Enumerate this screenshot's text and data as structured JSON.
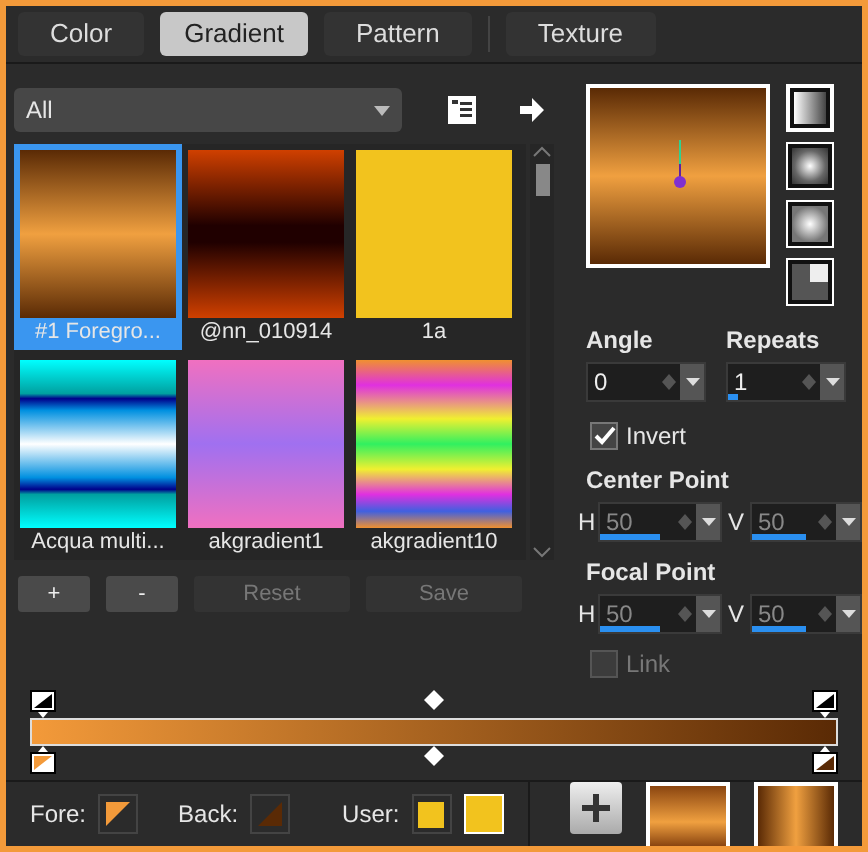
{
  "tabs": [
    {
      "label": "Color",
      "selected": false
    },
    {
      "label": "Gradient",
      "selected": true
    },
    {
      "label": "Pattern",
      "selected": false
    },
    {
      "label": "Texture",
      "selected": false
    }
  ],
  "category_dropdown": {
    "value": "All"
  },
  "gradients": [
    {
      "name": "#1 Foregro...",
      "selected": true
    },
    {
      "name": "@nn_010914",
      "selected": false
    },
    {
      "name": "1a",
      "selected": false
    },
    {
      "name": "Acqua multi...",
      "selected": false
    },
    {
      "name": "akgradient1",
      "selected": false
    },
    {
      "name": "akgradient10",
      "selected": false
    }
  ],
  "library_buttons": [
    {
      "label": "+",
      "disabled": false
    },
    {
      "label": "-",
      "disabled": false
    },
    {
      "label": "Reset",
      "disabled": true
    },
    {
      "label": "Save",
      "disabled": true
    }
  ],
  "style_buttons": [
    {
      "selected": true
    },
    {
      "selected": false
    },
    {
      "selected": false
    },
    {
      "selected": false
    }
  ],
  "angle": {
    "label": "Angle",
    "value": "0"
  },
  "repeats": {
    "label": "Repeats",
    "value": "1",
    "level": 0.08
  },
  "invert": {
    "label": "Invert",
    "checked": true
  },
  "center_point": {
    "label": "Center Point",
    "h": {
      "label": "H",
      "value": "50",
      "level": 0.5
    },
    "v": {
      "label": "V",
      "value": "50",
      "level": 0.5
    },
    "disabled": true
  },
  "focal_point": {
    "label": "Focal Point",
    "h": {
      "label": "H",
      "value": "50",
      "level": 0.5
    },
    "v": {
      "label": "V",
      "value": "50",
      "level": 0.5
    },
    "disabled": true
  },
  "link": {
    "label": "Link",
    "checked": false,
    "disabled": true
  },
  "fore": {
    "label": "Fore:"
  },
  "back": {
    "label": "Back:"
  },
  "user": {
    "label": "User:"
  }
}
